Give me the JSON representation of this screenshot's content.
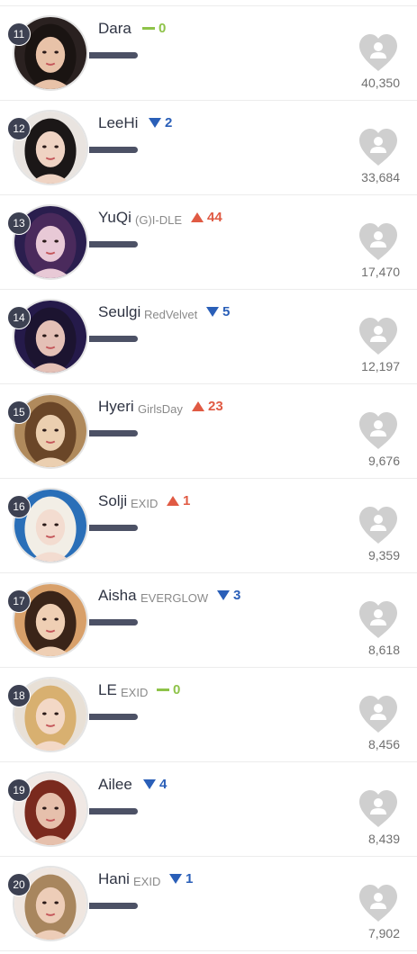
{
  "colors": {
    "rank_badge": "#3d4152",
    "progress_bar": "#4c5165",
    "up": "#e05a43",
    "down": "#2a5fb8",
    "same": "#8ec349",
    "heart": "#cfcfcf"
  },
  "icons": {
    "vote": "heart-person-icon",
    "up": "triangle-up-icon",
    "down": "triangle-down-icon",
    "same": "dash-icon"
  },
  "rows": [
    {
      "rank": "11",
      "name": "Dara",
      "group": "",
      "direction": "same",
      "change": "0",
      "votes": "40,350",
      "avatar_bg": "#2a2120",
      "avatar_skin": "#e8c2a8",
      "avatar_hair": "#1a1412"
    },
    {
      "rank": "12",
      "name": "LeeHi",
      "group": "",
      "direction": "down",
      "change": "2",
      "votes": "33,684",
      "avatar_bg": "#e9e4e0",
      "avatar_skin": "#efd3c3",
      "avatar_hair": "#1b1717"
    },
    {
      "rank": "13",
      "name": "YuQi",
      "group": "(G)I-DLE",
      "direction": "up",
      "change": "44",
      "votes": "17,470",
      "avatar_bg": "#2a1e4e",
      "avatar_skin": "#e8c9d6",
      "avatar_hair": "#4a2a5c"
    },
    {
      "rank": "14",
      "name": "Seulgi",
      "group": "RedVelvet",
      "direction": "down",
      "change": "5",
      "votes": "12,197",
      "avatar_bg": "#251a4a",
      "avatar_skin": "#e4c0b6",
      "avatar_hair": "#1c1430"
    },
    {
      "rank": "15",
      "name": "Hyeri",
      "group": "GirlsDay",
      "direction": "up",
      "change": "23",
      "votes": "9,676",
      "avatar_bg": "#b08a5c",
      "avatar_skin": "#ebcfb0",
      "avatar_hair": "#6a4628"
    },
    {
      "rank": "16",
      "name": "Solji",
      "group": "EXID",
      "direction": "up",
      "change": "1",
      "votes": "9,359",
      "avatar_bg": "#2a6fb8",
      "avatar_skin": "#f3dcd0",
      "avatar_hair": "#f2eee6"
    },
    {
      "rank": "17",
      "name": "Aisha",
      "group": "EVERGLOW",
      "direction": "down",
      "change": "3",
      "votes": "8,618",
      "avatar_bg": "#d8a06a",
      "avatar_skin": "#efcfb4",
      "avatar_hair": "#3a2418"
    },
    {
      "rank": "18",
      "name": "LE",
      "group": "EXID",
      "direction": "same",
      "change": "0",
      "votes": "8,456",
      "avatar_bg": "#e8e0d6",
      "avatar_skin": "#f3d8c6",
      "avatar_hair": "#d8b070"
    },
    {
      "rank": "19",
      "name": "Ailee",
      "group": "",
      "direction": "down",
      "change": "4",
      "votes": "8,439",
      "avatar_bg": "#f0e8e4",
      "avatar_skin": "#e6c0ac",
      "avatar_hair": "#7a2a1e"
    },
    {
      "rank": "20",
      "name": "Hani",
      "group": "EXID",
      "direction": "down",
      "change": "1",
      "votes": "7,902",
      "avatar_bg": "#efe6e0",
      "avatar_skin": "#edcdb8",
      "avatar_hair": "#a8865e"
    }
  ]
}
